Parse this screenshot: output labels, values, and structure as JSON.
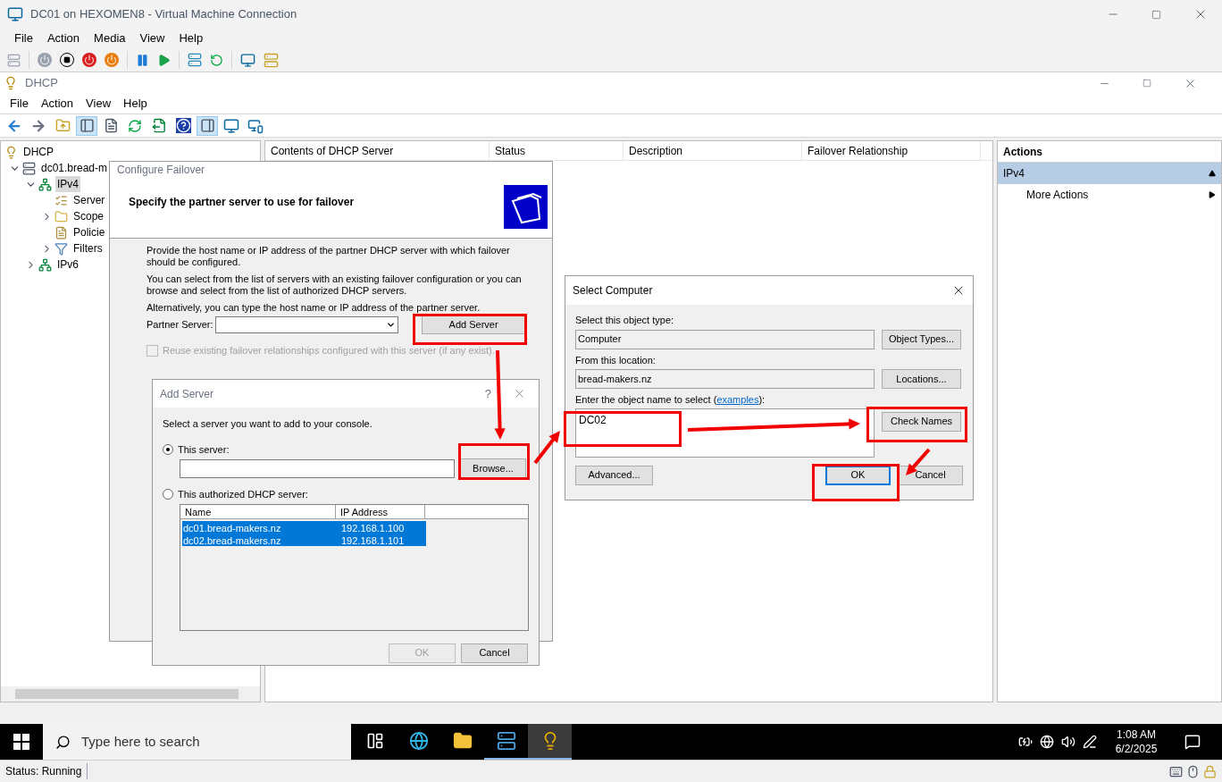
{
  "vm_window": {
    "title": "DC01 on HEXOMEN8 - Virtual Machine Connection",
    "menu": [
      "File",
      "Action",
      "Media",
      "View",
      "Help"
    ],
    "status": "Status: Running"
  },
  "mmc": {
    "title": "DHCP",
    "menu": [
      "File",
      "Action",
      "View",
      "Help"
    ],
    "toolbar": [
      {
        "kind": "back",
        "pressed": false
      },
      {
        "kind": "forward",
        "pressed": false
      },
      {
        "kind": "up",
        "pressed": false
      },
      {
        "kind": "tree",
        "pressed": true
      },
      {
        "kind": "properties",
        "pressed": false
      },
      {
        "kind": "refresh",
        "pressed": false
      },
      {
        "kind": "export",
        "pressed": false
      },
      {
        "kind": "help",
        "pressed": false
      },
      {
        "kind": "actionpane",
        "pressed": true
      },
      {
        "kind": "monitor",
        "pressed": false
      },
      {
        "kind": "monitors",
        "pressed": false
      }
    ],
    "tree": [
      {
        "label": "DHCP",
        "kind": "dhcp",
        "selected": false,
        "children": [
          {
            "label": "dc01.bread-m",
            "kind": "server",
            "expanded": true,
            "selected": false,
            "children": [
              {
                "label": "IPv4",
                "kind": "network",
                "expanded": true,
                "selected": true,
                "children": [
                  {
                    "label": "Server",
                    "kind": "options",
                    "selected": false
                  },
                  {
                    "label": "Scope",
                    "kind": "folder",
                    "expanded": false,
                    "selected": false
                  },
                  {
                    "label": "Policie",
                    "kind": "policy",
                    "selected": false
                  },
                  {
                    "label": "Filters",
                    "kind": "filter",
                    "expanded": false,
                    "selected": false
                  }
                ]
              },
              {
                "label": "IPv6",
                "kind": "network",
                "expanded": false,
                "selected": false
              }
            ]
          }
        ]
      }
    ],
    "columns": [
      "Contents of DHCP Server",
      "Status",
      "Description",
      "Failover Relationship"
    ],
    "actions": {
      "heading": "Actions",
      "section": {
        "label": "IPv4",
        "expanded": true
      },
      "items": [
        "More Actions"
      ]
    }
  },
  "configure_failover": {
    "title": "Configure Failover",
    "heading": "Specify the partner server to use for failover",
    "paragraphs": [
      "Provide the host name or IP address of the partner DHCP server with which failover should be configured.",
      "You can select from the list of servers with an existing failover configuration or you can browse and select from the list of authorized DHCP servers.",
      "Alternatively, you can type the host name or IP address of the partner server."
    ],
    "partner_label": "Partner Server:",
    "add_button": "Add Server",
    "reuse": {
      "label": "Reuse existing failover relationships configured with this server (if any exist).",
      "checked": false,
      "disabled": true
    }
  },
  "add_server": {
    "title": "Add Server",
    "help": "?",
    "instruction": "Select a server you want to add to your console.",
    "options": [
      {
        "label": "This server:",
        "selected": true
      },
      {
        "label": "This authorized DHCP server:",
        "selected": false
      }
    ],
    "browse": "Browse...",
    "columns": [
      "Name",
      "IP Address"
    ],
    "rows": [
      {
        "name": "dc01.bread-makers.nz",
        "ip": "192.168.1.100",
        "selected": true
      },
      {
        "name": "dc02.bread-makers.nz",
        "ip": "192.168.1.101",
        "selected": true
      }
    ],
    "buttons": [
      {
        "label": "OK",
        "disabled": true
      },
      {
        "label": "Cancel",
        "disabled": false
      }
    ]
  },
  "select_computer": {
    "title": "Select Computer",
    "fields": [
      {
        "label": "Select this object type:",
        "value": "Computer",
        "button": "Object Types..."
      },
      {
        "label": "From this location:",
        "value": "bread-makers.nz",
        "button": "Locations..."
      }
    ],
    "name_label": "Enter the object name to select (",
    "name_link": "examples",
    "name_label_end": "):",
    "name_value": "DC02",
    "check": "Check Names",
    "advanced": "Advanced...",
    "buttons": [
      {
        "label": "OK",
        "default": true
      },
      {
        "label": "Cancel",
        "default": false
      }
    ]
  },
  "taskbar": {
    "search": "Type here to search",
    "time": "1:08 AM",
    "date": "6/2/2025",
    "apps": [
      {
        "kind": "taskview",
        "running": false,
        "selected": false
      },
      {
        "kind": "browser",
        "running": false,
        "selected": false
      },
      {
        "kind": "files",
        "running": false,
        "selected": false
      },
      {
        "kind": "servermanager",
        "running": true,
        "selected": false
      },
      {
        "kind": "dhcp",
        "running": true,
        "selected": true
      }
    ]
  }
}
